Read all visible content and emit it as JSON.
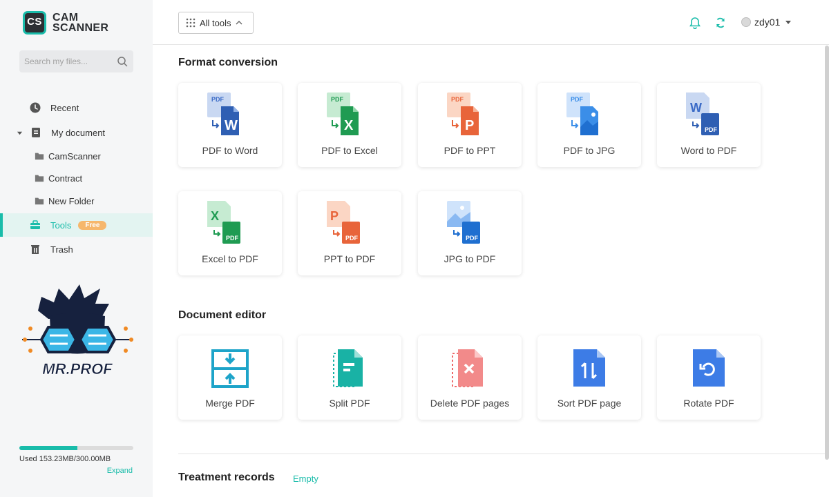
{
  "brand": {
    "badge": "CS",
    "line1": "CAM",
    "line2": "SCANNER",
    "accent": "#19bcaa"
  },
  "search": {
    "placeholder": "Search my files..."
  },
  "sidebar": {
    "items": [
      {
        "label": "Recent"
      },
      {
        "label": "My document"
      },
      {
        "label": "CamScanner"
      },
      {
        "label": "Contract"
      },
      {
        "label": "New Folder"
      },
      {
        "label": "Tools",
        "badge": "Free"
      },
      {
        "label": "Trash"
      }
    ],
    "watermark_text": "MR.PROF"
  },
  "storage": {
    "used_text": "Used 153.23MB/300.00MB",
    "used_fraction": 0.51,
    "expand": "Expand"
  },
  "header": {
    "all_tools": "All tools",
    "username": "zdy01"
  },
  "format_conversion": {
    "title": "Format conversion",
    "tools": [
      {
        "label": "PDF to Word",
        "icon": "pdf-to-word-icon"
      },
      {
        "label": "PDF to Excel",
        "icon": "pdf-to-excel-icon"
      },
      {
        "label": "PDF to PPT",
        "icon": "pdf-to-ppt-icon"
      },
      {
        "label": "PDF to JPG",
        "icon": "pdf-to-jpg-icon"
      },
      {
        "label": "Word to PDF",
        "icon": "word-to-pdf-icon"
      },
      {
        "label": "Excel to PDF",
        "icon": "excel-to-pdf-icon"
      },
      {
        "label": "PPT to PDF",
        "icon": "ppt-to-pdf-icon"
      },
      {
        "label": "JPG to PDF",
        "icon": "jpg-to-pdf-icon"
      }
    ]
  },
  "document_editor": {
    "title": "Document editor",
    "tools": [
      {
        "label": "Merge PDF",
        "icon": "merge-pdf-icon"
      },
      {
        "label": "Split PDF",
        "icon": "split-pdf-icon"
      },
      {
        "label": "Delete PDF pages",
        "icon": "delete-pages-icon"
      },
      {
        "label": "Sort PDF page",
        "icon": "sort-pages-icon"
      },
      {
        "label": "Rotate PDF",
        "icon": "rotate-pdf-icon"
      }
    ]
  },
  "records": {
    "title": "Treatment records",
    "status": "Empty"
  },
  "icon_text": {
    "pdf": "PDF",
    "word": "W",
    "excel": "X",
    "ppt": "P"
  }
}
